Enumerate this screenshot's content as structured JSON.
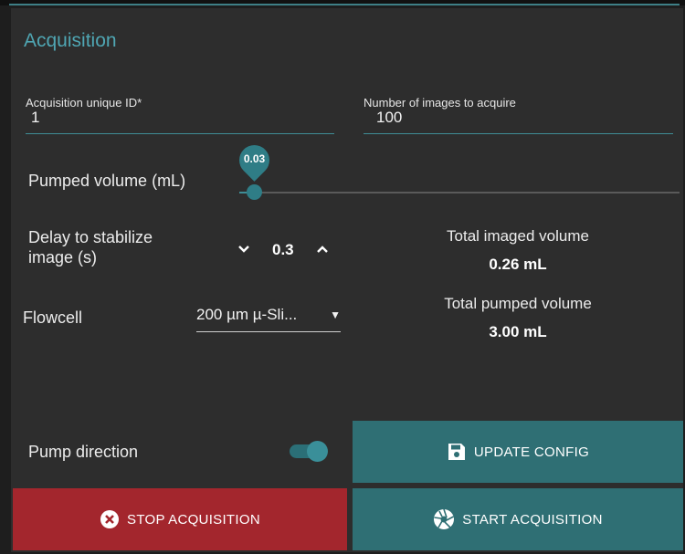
{
  "section": {
    "title": "Acquisition"
  },
  "fields": {
    "unique_id": {
      "label": "Acquisition unique ID*",
      "value": "1"
    },
    "num_images": {
      "label": "Number of images to acquire",
      "value": "100"
    }
  },
  "pumped_volume": {
    "label": "Pumped volume (mL)",
    "value": "0.03",
    "fraction": 0.01
  },
  "delay": {
    "label_line1": "Delay to stabilize",
    "label_line2": "image (s)",
    "value": "0.3",
    "decrement_icon": "chevron-down-icon",
    "increment_icon": "chevron-up-icon"
  },
  "stats": {
    "imaged": {
      "title": "Total imaged volume",
      "value": "0.26 mL"
    },
    "pumped": {
      "title": "Total pumped volume",
      "value": "3.00 mL"
    }
  },
  "flowcell": {
    "label": "Flowcell",
    "selected": "200 µm µ-Sli...",
    "caret_icon": "caret-down-icon"
  },
  "pump_direction": {
    "label": "Pump direction",
    "on": true
  },
  "buttons": {
    "update": {
      "label": "UPDATE CONFIG",
      "icon": "save-icon"
    },
    "stop": {
      "label": "STOP ACQUISITION",
      "icon": "close-circle-icon"
    },
    "start": {
      "label": "START ACQUISITION",
      "icon": "aperture-icon"
    }
  },
  "colors": {
    "accent": "#4fa6b3",
    "teal_button": "#2f6f74",
    "stop_button": "#a3262d",
    "panel": "#2d2d2d"
  }
}
